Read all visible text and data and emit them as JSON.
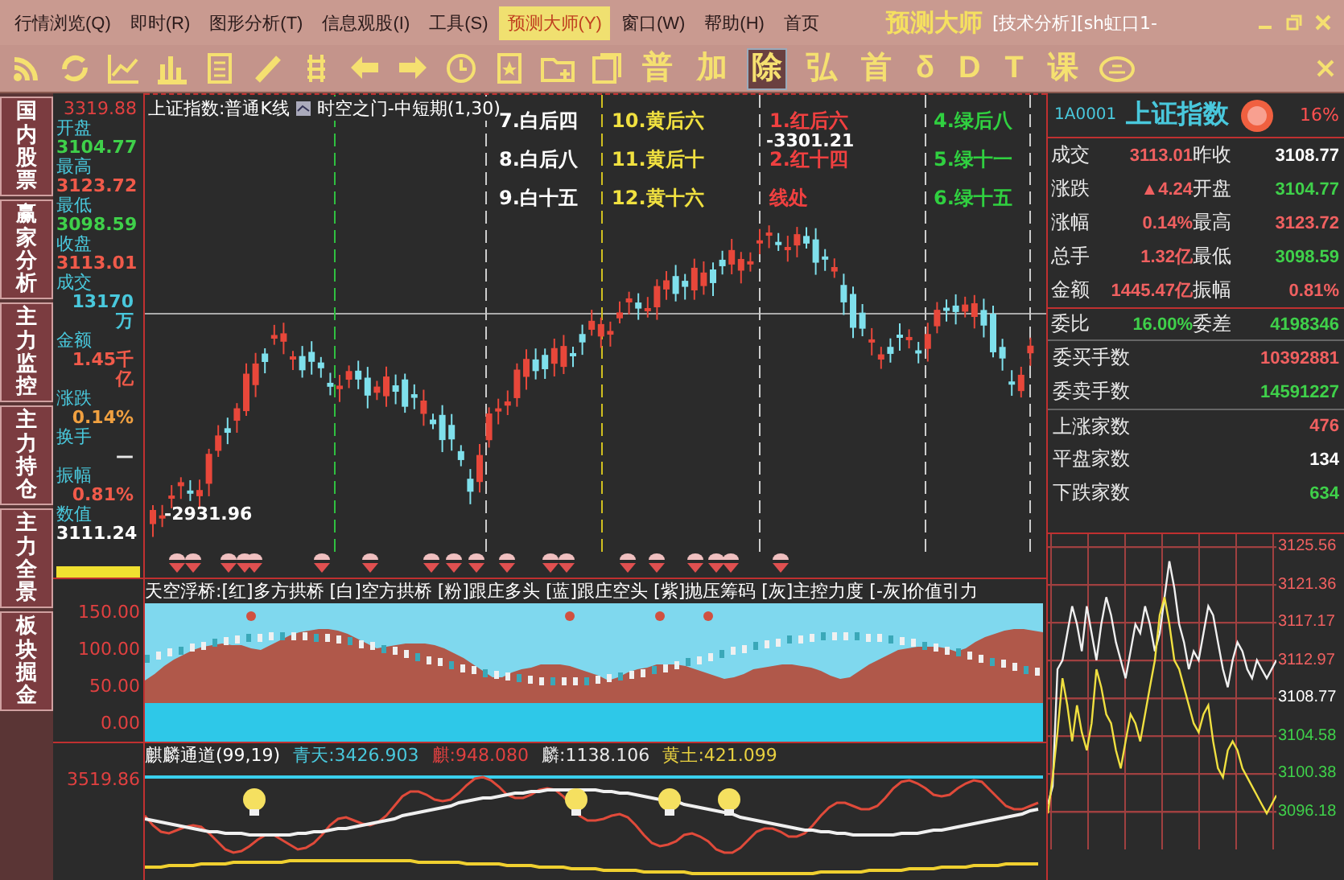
{
  "menu_bar": {
    "items": [
      {
        "label": "行情浏览(Q)",
        "selected": false
      },
      {
        "label": "即时(R)",
        "selected": false
      },
      {
        "label": "图形分析(T)",
        "selected": false
      },
      {
        "label": "信息观股(I)",
        "selected": false
      },
      {
        "label": "工具(S)",
        "selected": false
      },
      {
        "label": "预测大师(Y)",
        "selected": true
      },
      {
        "label": "窗口(W)",
        "selected": false
      },
      {
        "label": "帮助(H)",
        "selected": false
      },
      {
        "label": "首页",
        "selected": false
      }
    ],
    "app_title": "预测大师",
    "subtitle": "[技术分析][sh虹口1-"
  },
  "toolbar": {
    "glyphs": [
      {
        "text": "普",
        "selected": false
      },
      {
        "text": "加",
        "selected": false
      },
      {
        "text": "除",
        "selected": true
      },
      {
        "text": "弘",
        "selected": false
      },
      {
        "text": "首",
        "selected": false
      },
      {
        "text": "δ",
        "selected": false
      },
      {
        "text": "D",
        "selected": false
      },
      {
        "text": "T",
        "selected": false
      },
      {
        "text": "课",
        "selected": false
      }
    ]
  },
  "sidebar": {
    "tabs": [
      {
        "label": "国内股票",
        "selected": false
      },
      {
        "label": "赢家分析",
        "selected": false
      },
      {
        "label": "主力监控",
        "selected": false
      },
      {
        "label": "主力持仓",
        "selected": false
      },
      {
        "label": "主力全景",
        "selected": false
      },
      {
        "label": "板块掘金",
        "selected": false
      }
    ]
  },
  "quote_info": {
    "top_value": "3319.88",
    "fields": [
      {
        "label": "开盘",
        "value": "3104.77",
        "color": "#3fd04a"
      },
      {
        "label": "最高",
        "value": "3123.72",
        "color": "#f05a4a"
      },
      {
        "label": "最低",
        "value": "3098.59",
        "color": "#3fd04a"
      },
      {
        "label": "收盘",
        "value": "3113.01",
        "color": "#f05a4a"
      },
      {
        "label": "成交",
        "value": "13170万",
        "color": "#49c8dc"
      },
      {
        "label": "金额",
        "value": "1.45千亿",
        "color": "#f05a4a"
      },
      {
        "label": "涨跌",
        "value": "0.14%",
        "color": "#f0a040"
      },
      {
        "label": "换手",
        "value": "—",
        "color": "#e8e8e8"
      },
      {
        "label": "振幅",
        "value": "0.81%",
        "color": "#f05a4a"
      },
      {
        "label": "数值",
        "value": "3111.24",
        "color": "#ffffff"
      }
    ]
  },
  "kline_chart": {
    "title": "上证指数:普通K线",
    "indicator": "时空之门-中短期(1,30)",
    "high_label": "-3301.21",
    "low_label": "-2931.96",
    "annotation_groups": [
      {
        "color": "#ffffff",
        "items": [
          "7.白后四",
          "8.白后八",
          "9.白十五"
        ]
      },
      {
        "color": "#f0e040",
        "items": [
          "10.黄后六",
          "11.黄后十",
          "12.黄十六"
        ]
      },
      {
        "color": "#f04040",
        "items": [
          "1.红后六",
          "2.红十四",
          "线处"
        ]
      },
      {
        "color": "#30d040",
        "items": [
          "4.绿后八",
          "5.绿十一",
          "6.绿十五"
        ]
      }
    ]
  },
  "indicator_panel": {
    "title": "天空浮桥:[红]多方拱桥 [白]空方拱桥 [粉]跟庄多头 [蓝]跟庄空头 [紫]抛压筹码 [灰]主控力度 [-灰]价值引力",
    "yticks": [
      "150.00",
      "100.00",
      "50.00",
      "0.00"
    ]
  },
  "channel_panel": {
    "title": "麒麟通道(99,19)",
    "top_label": "3519.86",
    "values": [
      {
        "text": "青天:3426.903",
        "color": "#49c8dc"
      },
      {
        "text": "麒:948.080",
        "color": "#e04040"
      },
      {
        "text": "麟:1138.106",
        "color": "#e8e8e8"
      },
      {
        "text": "黄土:421.099",
        "color": "#e8d040"
      }
    ]
  },
  "quote_panel": {
    "code": "1A0001",
    "name": "上证指数",
    "badge": "16%",
    "pair_rows": [
      {
        "cells": [
          {
            "label": "成交",
            "value": "3113.01",
            "color": "#f06060"
          },
          {
            "label": "昨收",
            "value": "3108.77",
            "color": "#ffffff"
          }
        ]
      },
      {
        "cells": [
          {
            "label": "涨跌",
            "value": "▲4.24",
            "color": "#f06060"
          },
          {
            "label": "开盘",
            "value": "3104.77",
            "color": "#3fd04a"
          }
        ]
      },
      {
        "cells": [
          {
            "label": "涨幅",
            "value": "0.14%",
            "color": "#f06060"
          },
          {
            "label": "最高",
            "value": "3123.72",
            "color": "#f06060"
          }
        ]
      },
      {
        "cells": [
          {
            "label": "总手",
            "value": "1.32亿",
            "color": "#f06060"
          },
          {
            "label": "最低",
            "value": "3098.59",
            "color": "#3fd04a"
          }
        ]
      },
      {
        "cells": [
          {
            "label": "金额",
            "value": "1445.47亿",
            "color": "#f06060"
          },
          {
            "label": "振幅",
            "value": "0.81%",
            "color": "#f06060"
          }
        ]
      },
      {
        "cells": [
          {
            "label": "委比",
            "value": "16.00%",
            "color": "#3fd04a"
          },
          {
            "label": "委差",
            "value": "4198346",
            "color": "#3fd04a"
          }
        ]
      }
    ],
    "rows": [
      {
        "label": "委买手数",
        "value": "10392881",
        "color": "#f06060"
      },
      {
        "label": "委卖手数",
        "value": "14591227",
        "color": "#3fd04a"
      },
      {
        "label": "上涨家数",
        "value": "476",
        "color": "#f06060"
      },
      {
        "label": "平盘家数",
        "value": "134",
        "color": "#ffffff"
      },
      {
        "label": "下跌家数",
        "value": "634",
        "color": "#3fd04a"
      }
    ]
  },
  "intraday": {
    "chart_data": {
      "type": "line",
      "ylim": [
        3092.0,
        3127.0
      ],
      "grid": true,
      "yticks": [
        {
          "value": 3125.56,
          "label": "3125.56"
        },
        {
          "value": 3121.36,
          "label": "3121.36"
        },
        {
          "value": 3117.17,
          "label": "3117.17"
        },
        {
          "value": 3112.97,
          "label": "3112.97"
        },
        {
          "value": 3108.77,
          "label": "3108.77"
        },
        {
          "value": 3104.58,
          "label": "3104.58"
        },
        {
          "value": 3100.38,
          "label": "3100.38"
        },
        {
          "value": 3096.18,
          "label": "3096.18"
        }
      ],
      "series": [
        {
          "color": "#f0f0f0",
          "values": [
            3097,
            3099,
            3112,
            3113,
            3116,
            3119,
            3117,
            3114,
            3119,
            3116,
            3113,
            3117,
            3120,
            3118,
            3115,
            3113,
            3111,
            3114,
            3117,
            3116,
            3119,
            3117,
            3114,
            3116,
            3120,
            3124,
            3121,
            3117,
            3115,
            3112,
            3114,
            3113,
            3116,
            3119,
            3118,
            3115,
            3112,
            3110,
            3113,
            3115,
            3114,
            3112,
            3111,
            3113,
            3112,
            3111,
            3112,
            3113
          ]
        },
        {
          "color": "#f0e040",
          "values": [
            3096,
            3100,
            3105,
            3111,
            3108,
            3104,
            3108,
            3105,
            3103,
            3106,
            3112,
            3110,
            3107,
            3106,
            3103,
            3101,
            3104,
            3107,
            3106,
            3104,
            3107,
            3110,
            3113,
            3118,
            3120,
            3117,
            3113,
            3112,
            3110,
            3108,
            3106,
            3105,
            3107,
            3108,
            3104,
            3101,
            3100,
            3103,
            3104,
            3103,
            3101,
            3100,
            3099,
            3098,
            3097,
            3096,
            3097,
            3098
          ]
        }
      ]
    }
  }
}
